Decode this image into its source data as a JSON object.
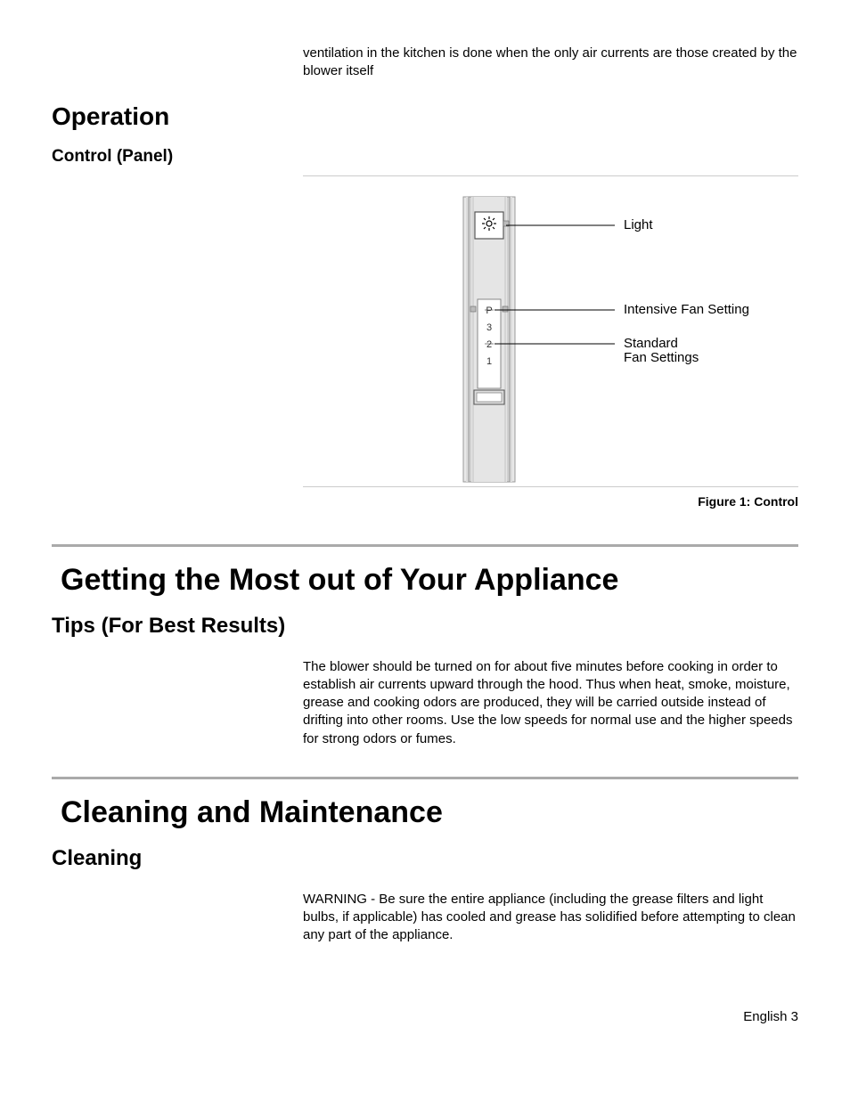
{
  "intro": "ventilation in the kitchen is done when the only air currents are those created by the blower itself",
  "section_operation": {
    "heading": "Operation",
    "subheading": "Control (Panel)"
  },
  "figure": {
    "caption": "Figure 1: Control",
    "labels": {
      "light": "Light",
      "intensive": "Intensive Fan Setting",
      "standard_line1": "Standard",
      "standard_line2": "Fan Settings",
      "p": "P",
      "n3": "3",
      "n2": "2",
      "n1": "1"
    }
  },
  "section_getting_most": {
    "title": "Getting the Most out of Your Appliance",
    "subheading": "Tips (For Best Results)",
    "body": "The blower should be turned on for about five minutes before cooking in order to establish air currents upward through the hood. Thus when heat, smoke, moisture, grease and cooking odors are produced, they will be carried outside instead of drifting into other rooms. Use the low speeds for normal use and the higher speeds for strong odors or fumes."
  },
  "section_cleaning": {
    "title": "Cleaning and Maintenance",
    "subheading": "Cleaning",
    "body": "WARNING - Be sure the entire appliance (including the grease filters and light bulbs, if applicable) has cooled and grease has solidified before attempting to clean any part of the appliance."
  },
  "footer": "English 3"
}
